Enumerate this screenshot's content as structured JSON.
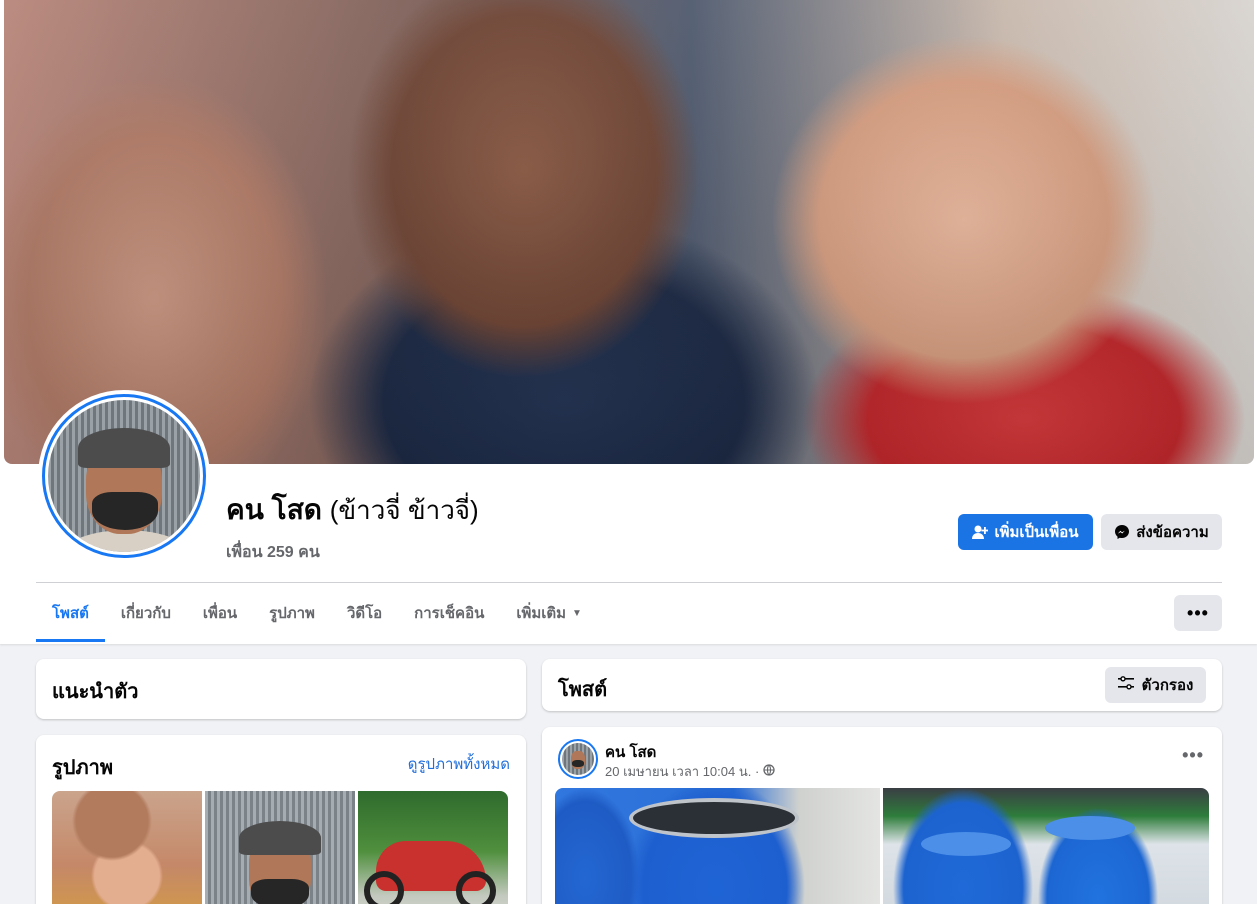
{
  "profile": {
    "name": "คน โสด",
    "alternate_name": "(ข้าวจี่ ข้าวจี่)",
    "friends": "เพื่อน 259 คน",
    "add_friend_label": "เพิ่มเป็นเพื่อน",
    "message_label": "ส่งข้อความ"
  },
  "tabs": [
    {
      "label": "โพสต์",
      "active": true
    },
    {
      "label": "เกี่ยวกับ"
    },
    {
      "label": "เพื่อน"
    },
    {
      "label": "รูปภาพ"
    },
    {
      "label": "วิดีโอ"
    },
    {
      "label": "การเช็คอิน"
    },
    {
      "label": "เพิ่มเติม"
    }
  ],
  "intro": {
    "title": "แนะนำตัว"
  },
  "photos": {
    "title": "รูปภาพ",
    "see_all": "ดูรูปภาพทั้งหมด"
  },
  "posts": {
    "title": "โพสต์",
    "filter_label": "ตัวกรอง"
  },
  "post": {
    "author": "คน โสด",
    "meta": "20 เมษายน เวลา 10:04 น. ·",
    "privacy_icon": "globe-icon"
  },
  "colors": {
    "accent": "#1877f2",
    "button_primary": "#1b74e4",
    "background": "#f0f2f5",
    "secondary_button": "#e4e6eb"
  }
}
